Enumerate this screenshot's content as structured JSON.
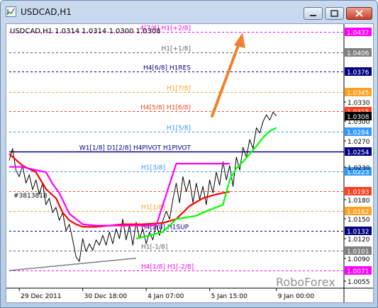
{
  "window": {
    "title": "USDCAD,H1",
    "app_icon": "chart-icon",
    "buttons": {
      "minimize": "minimize-icon",
      "maximize": "maximize-icon",
      "close": "close-icon"
    }
  },
  "chart_header": "USDCAD,H1  1.0314 1.0314 1.0300 1.0308",
  "watermark": "RoboForex",
  "annotation_label": "#3813818",
  "colors": {
    "price_line": "#000000",
    "envelope_red": "#ff0000",
    "envelope_magenta": "#ff00ff",
    "envelope_green": "#00ff00",
    "trend_line": "#7f7f7f",
    "arrow": "#f08030",
    "pivot_line": "#00007f",
    "current_price_bg": "#000000"
  },
  "chart_data": {
    "type": "line",
    "symbol": "USDCAD",
    "timeframe": "H1",
    "ohlc_header": {
      "open": 1.0314,
      "high": 1.0314,
      "low": 1.03,
      "close": 1.0308
    },
    "ylim": [
      1.0045,
      1.0447
    ],
    "xlim": [
      0,
      100
    ],
    "x_tick_labels": [
      {
        "label": "29 Dec 2011",
        "x": 3
      },
      {
        "label": "30 Dec 18:00",
        "x": 22
      },
      {
        "label": "4 Jan 07:00",
        "x": 41
      },
      {
        "label": "5 Jan 15:00",
        "x": 60
      },
      {
        "label": "9 Jan 00:00",
        "x": 80
      }
    ],
    "y_tick_labels": [
      1.033,
      1.03,
      1.027,
      1.023,
      1.018,
      1.015,
      1.012,
      1.009,
      1.0055
    ],
    "price_tags": [
      {
        "value": "1.0437",
        "bg": "#ff00ff",
        "fg": "#ffffff"
      },
      {
        "value": "1.0406",
        "bg": "#808080",
        "fg": "#ffffff"
      },
      {
        "value": "1.0376",
        "bg": "#000080",
        "fg": "#ffffff"
      },
      {
        "value": "1.0345",
        "bg": "#ffa020",
        "fg": "#ffffff"
      },
      {
        "value": "1.0315",
        "bg": "#ff4020",
        "fg": "#ffffff"
      },
      {
        "value": "1.0308",
        "bg": "#000000",
        "fg": "#ffffff"
      },
      {
        "value": "1.0284",
        "bg": "#3399ff",
        "fg": "#ffffff"
      },
      {
        "value": "1.0254",
        "bg": "#000080",
        "fg": "#ffffff"
      },
      {
        "value": "1.0223",
        "bg": "#3399ff",
        "fg": "#ffffff"
      },
      {
        "value": "1.0193",
        "bg": "#ff4020",
        "fg": "#ffffff"
      },
      {
        "value": "1.0162",
        "bg": "#ffa020",
        "fg": "#ffffff"
      },
      {
        "value": "1.0132",
        "bg": "#000080",
        "fg": "#ffffff"
      },
      {
        "value": "1.0101",
        "bg": "#808080",
        "fg": "#ffffff"
      },
      {
        "value": "1.0071",
        "bg": "#ff00ff",
        "fg": "#ffffff"
      }
    ],
    "levels": [
      {
        "label": "4[7/8] H1[+2/8]",
        "value": 1.0437,
        "color": "#ff00ff",
        "solid": false,
        "align": "right"
      },
      {
        "label": "H1[+1/8]",
        "value": 1.0406,
        "color": "#606060",
        "solid": false,
        "align": "right"
      },
      {
        "label": "H4[6/8] H1RES",
        "value": 1.0376,
        "color": "#000080",
        "solid": false,
        "align": "right"
      },
      {
        "label": "H1[7/8]",
        "value": 1.0345,
        "color": "#ffa020",
        "solid": false,
        "align": "right"
      },
      {
        "label": "H4[5/8] H1[6/8]",
        "value": 1.0315,
        "color": "#ff4020",
        "solid": false,
        "align": "right"
      },
      {
        "label": "H1[5/8]",
        "value": 1.0284,
        "color": "#3399ff",
        "solid": false,
        "align": "right"
      },
      {
        "label": "W1[1/8] D1[2/8] H4PIVOT H1PIVOT",
        "value": 1.0254,
        "color": "#000080",
        "solid": true,
        "align": "right"
      },
      {
        "label": "H1[3/8]",
        "value": 1.0223,
        "color": "#3399ff",
        "solid": false,
        "align": "left"
      },
      {
        "label": "",
        "value": 1.0193,
        "color": "#ff4020",
        "solid": false,
        "align": "right"
      },
      {
        "label": "H1[1/8]",
        "value": 1.0162,
        "color": "#ffa020",
        "solid": false,
        "align": "left"
      },
      {
        "label": "H4[2/8] H1SUP",
        "value": 1.0132,
        "color": "#000080",
        "solid": false,
        "align": "left"
      },
      {
        "label": "H1[-1/8]",
        "value": 1.0101,
        "color": "#606060",
        "solid": false,
        "align": "left"
      },
      {
        "label": "H4[1/8] H1[-2/8]",
        "value": 1.0071,
        "color": "#ff00ff",
        "solid": false,
        "align": "left"
      }
    ],
    "series": [
      {
        "kind": "price",
        "color": "#000000",
        "points": [
          [
            0,
            1.024
          ],
          [
            1,
            1.0258
          ],
          [
            2,
            1.0225
          ],
          [
            3,
            1.0215
          ],
          [
            4,
            1.0232
          ],
          [
            5,
            1.0205
          ],
          [
            6,
            1.0218
          ],
          [
            7,
            1.0195
          ],
          [
            8,
            1.021
          ],
          [
            9,
            1.0188
          ],
          [
            10,
            1.0205
          ],
          [
            11,
            1.0172
          ],
          [
            12,
            1.0182
          ],
          [
            13,
            1.016
          ],
          [
            14,
            1.0168
          ],
          [
            15,
            1.0148
          ],
          [
            16,
            1.016
          ],
          [
            17,
            1.0132
          ],
          [
            18,
            1.0142
          ],
          [
            19,
            1.0118
          ],
          [
            20,
            1.0092
          ],
          [
            21,
            1.0085
          ],
          [
            22,
            1.012
          ],
          [
            23,
            1.01
          ],
          [
            24,
            1.0112
          ],
          [
            25,
            1.0102
          ],
          [
            26,
            1.0118
          ],
          [
            27,
            1.011
          ],
          [
            28,
            1.0125
          ],
          [
            29,
            1.011
          ],
          [
            30,
            1.013
          ],
          [
            31,
            1.0112
          ],
          [
            32,
            1.0135
          ],
          [
            33,
            1.012
          ],
          [
            34,
            1.015
          ],
          [
            35,
            1.0118
          ],
          [
            36,
            1.014
          ],
          [
            37,
            1.011
          ],
          [
            38,
            1.0145
          ],
          [
            39,
            1.012
          ],
          [
            40,
            1.0135
          ],
          [
            41,
            1.0112
          ],
          [
            42,
            1.013
          ],
          [
            43,
            1.0118
          ],
          [
            44,
            1.0142
          ],
          [
            45,
            1.0125
          ],
          [
            46,
            1.0148
          ],
          [
            47,
            1.0162
          ],
          [
            48,
            1.015
          ],
          [
            49,
            1.018
          ],
          [
            50,
            1.0205
          ],
          [
            51,
            1.0175
          ],
          [
            52,
            1.0215
          ],
          [
            53,
            1.0192
          ],
          [
            54,
            1.021
          ],
          [
            55,
            1.0175
          ],
          [
            56,
            1.0205
          ],
          [
            57,
            1.018
          ],
          [
            58,
            1.02
          ],
          [
            59,
            1.0172
          ],
          [
            60,
            1.021
          ],
          [
            61,
            1.019
          ],
          [
            62,
            1.0222
          ],
          [
            63,
            1.0202
          ],
          [
            64,
            1.0238
          ],
          [
            65,
            1.021
          ],
          [
            66,
            1.0232
          ],
          [
            67,
            1.02
          ],
          [
            68,
            1.0245
          ],
          [
            69,
            1.0225
          ],
          [
            70,
            1.026
          ],
          [
            71,
            1.0245
          ],
          [
            72,
            1.0272
          ],
          [
            73,
            1.0258
          ],
          [
            74,
            1.029
          ],
          [
            75,
            1.0282
          ],
          [
            76,
            1.03
          ],
          [
            77,
            1.031
          ],
          [
            78,
            1.0302
          ],
          [
            79,
            1.0314
          ],
          [
            80,
            1.0308
          ]
        ]
      },
      {
        "kind": "envelope",
        "color": "#ff0000",
        "points": [
          [
            0,
            1.025
          ],
          [
            4,
            1.0232
          ],
          [
            8,
            1.0222
          ],
          [
            11,
            1.0196
          ],
          [
            14,
            1.0182
          ],
          [
            16,
            1.016
          ],
          [
            18,
            1.0148
          ],
          [
            20,
            1.0142
          ],
          [
            22,
            1.0138
          ],
          [
            26,
            1.0138
          ],
          [
            30,
            1.014
          ],
          [
            34,
            1.0142
          ],
          [
            40,
            1.0142
          ],
          [
            46,
            1.0144
          ],
          [
            50,
            1.015
          ],
          [
            54,
            1.017
          ],
          [
            58,
            1.0182
          ],
          [
            62,
            1.0188
          ],
          [
            66,
            1.0192
          ]
        ]
      },
      {
        "kind": "envelope",
        "color": "#ff00ff",
        "points": [
          [
            0,
            1.023
          ],
          [
            4,
            1.023
          ],
          [
            8,
            1.0225
          ],
          [
            11,
            1.0222
          ],
          [
            13,
            1.0204
          ],
          [
            15,
            1.019
          ],
          [
            18,
            1.0158
          ],
          [
            20,
            1.015
          ],
          [
            22,
            1.0142
          ],
          [
            26,
            1.014
          ],
          [
            30,
            1.014
          ],
          [
            36,
            1.014
          ],
          [
            40,
            1.014
          ],
          [
            44,
            1.014
          ],
          [
            50,
            1.0235
          ],
          [
            60,
            1.0235
          ],
          [
            66,
            1.0235
          ]
        ]
      },
      {
        "kind": "envelope",
        "color": "#00ff00",
        "points": [
          [
            38,
            1.012
          ],
          [
            42,
            1.0125
          ],
          [
            46,
            1.013
          ],
          [
            48,
            1.014
          ],
          [
            50,
            1.015
          ],
          [
            56,
            1.0155
          ],
          [
            58,
            1.016
          ],
          [
            64,
            1.0172
          ],
          [
            66,
            1.021
          ],
          [
            68,
            1.0228
          ],
          [
            70,
            1.0238
          ],
          [
            72,
            1.025
          ],
          [
            74,
            1.0262
          ],
          [
            76,
            1.0275
          ],
          [
            78,
            1.0285
          ],
          [
            80,
            1.029
          ]
        ]
      },
      {
        "kind": "trend",
        "color": "#7f7f7f",
        "points": [
          [
            0,
            1.0071
          ],
          [
            38,
            1.009
          ]
        ]
      }
    ]
  }
}
